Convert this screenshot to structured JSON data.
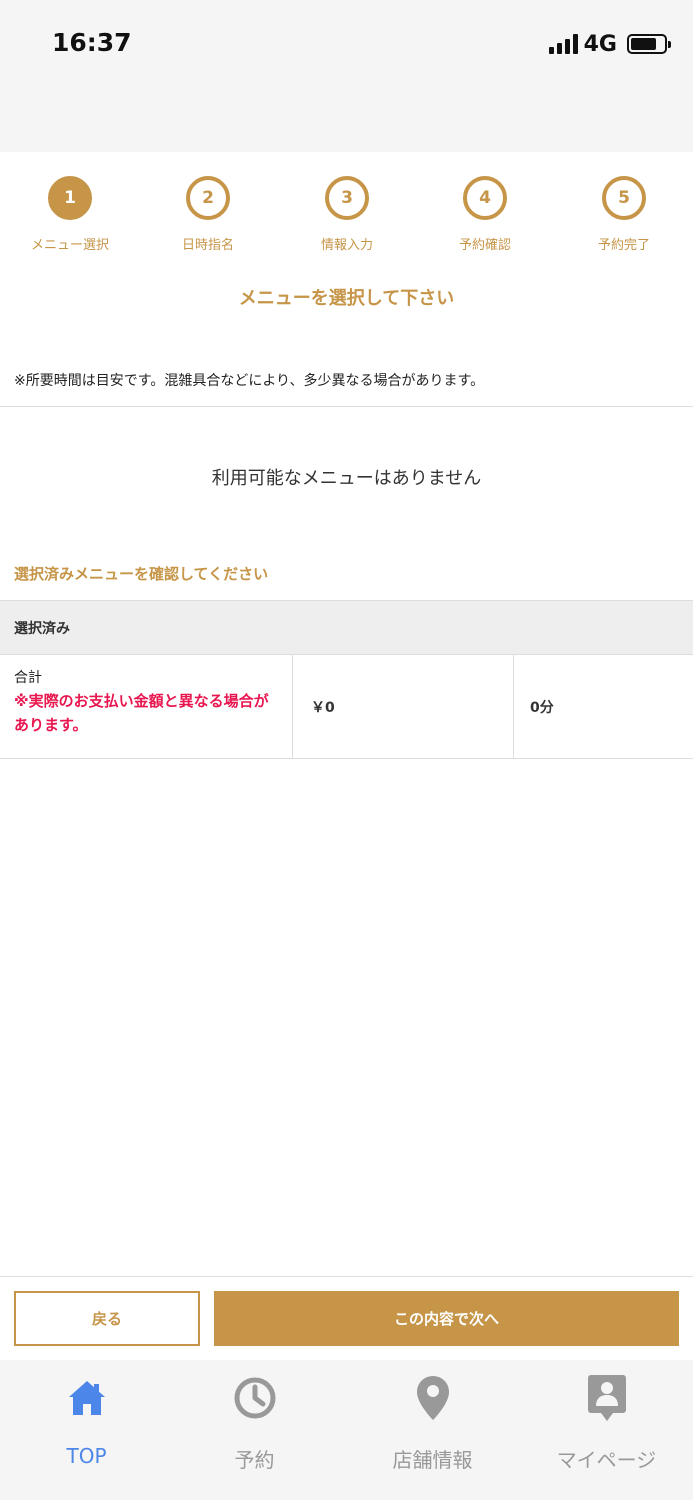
{
  "status_bar": {
    "time": "16:37",
    "network": "4G"
  },
  "steps": [
    {
      "number": "1",
      "label": "メニュー選択",
      "active": true
    },
    {
      "number": "2",
      "label": "日時指名",
      "active": false
    },
    {
      "number": "3",
      "label": "情報入力",
      "active": false
    },
    {
      "number": "4",
      "label": "予約確認",
      "active": false
    },
    {
      "number": "5",
      "label": "予約完了",
      "active": false
    }
  ],
  "main": {
    "heading": "メニューを選択して下さい",
    "note": "※所要時間は目安です。混雑具合などにより、多少異なる場合があります。",
    "empty_message": "利用可能なメニューはありません",
    "confirm_heading": "選択済みメニューを確認してください"
  },
  "selected": {
    "header": "選択済み",
    "total_label": "合計",
    "warning": "※実際のお支払い金額と異なる場合があります。",
    "price": "￥0",
    "duration": "0分"
  },
  "actions": {
    "back_label": "戻る",
    "next_label": "この内容で次へ"
  },
  "tab_bar": {
    "items": [
      {
        "label": "TOP",
        "icon": "home-icon",
        "active": true
      },
      {
        "label": "予約",
        "icon": "clock-icon",
        "active": false
      },
      {
        "label": "店舗情報",
        "icon": "location-pin-icon",
        "active": false
      },
      {
        "label": "マイページ",
        "icon": "profile-icon",
        "active": false
      }
    ]
  },
  "colors": {
    "accent": "#c69548",
    "warning": "#e8174f",
    "tab_active": "#4b86e8",
    "tab_inactive": "#999999"
  }
}
